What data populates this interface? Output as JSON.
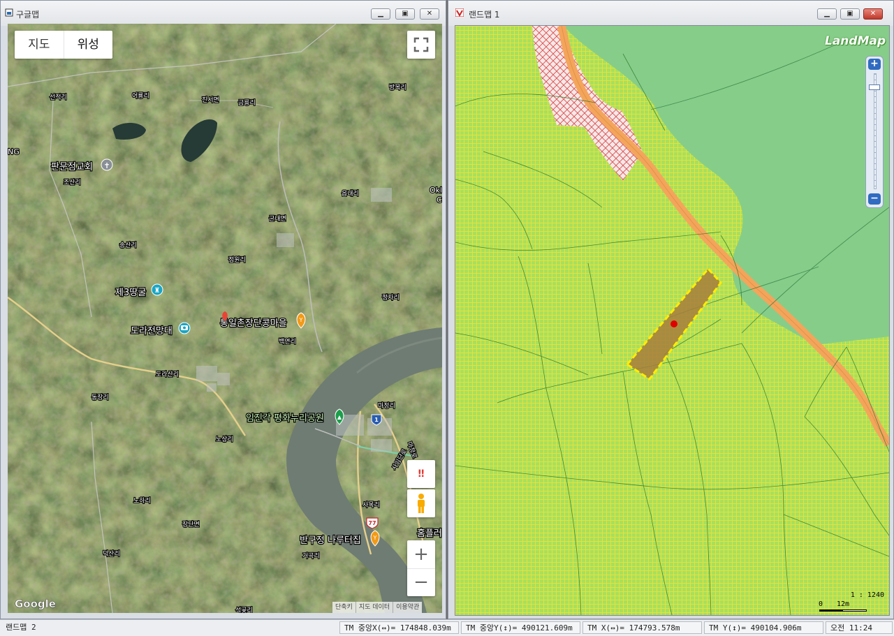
{
  "google_window": {
    "title": "구글맵",
    "controls": {
      "map_tab": "지도",
      "satellite_tab": "위성",
      "alert_glyph": "‼"
    },
    "labels_small": [
      "선적리",
      "어룡리",
      "진서면",
      "금릉리",
      "방목리",
      "조산리",
      "읍내리",
      "군내면",
      "송산리",
      "점원리",
      "정자리",
      "백연리",
      "도라산리",
      "마정리",
      "동장리",
      "노상리",
      "사목리",
      "노하리",
      "장단면",
      "거곡리",
      "덕산리",
      "석곶리",
      "NG",
      "Okl",
      "C",
      "마정로",
      "사임단로"
    ],
    "labels_large": [
      "판문점교회",
      "제3땅굴",
      "도라전망대",
      "통일촌장단콩마을",
      "임진각 평화누리공원",
      "반구정 나루터집",
      "홈플러"
    ],
    "road_shields": [
      "1",
      "77"
    ],
    "logo": "Google",
    "footer": [
      "단축키",
      "지도 데이터",
      "이용약관"
    ],
    "colors": {
      "water": "#6f7c73",
      "road": "#e6cf8c",
      "teal_road": "#7ccfa8"
    }
  },
  "landmap_window": {
    "title": "랜드맵 1",
    "logo": "LandMap",
    "scale": {
      "ratio": "1 : 1240",
      "zero": "0",
      "distance": "12m"
    },
    "colors": {
      "grid_fill": "#a6e05e",
      "grid_line": "#e6e23a",
      "forest": "#86cd89",
      "road": "#f4a55c",
      "hatch": "#dc4b4b",
      "parcel": "#a67d3c",
      "parcel_outline": "#ffee00",
      "marker": "#e00000"
    }
  },
  "statusbar": {
    "app": "랜드맵 2",
    "tm_center_x": "TM 중앙X(↔)= 174848.039m",
    "tm_center_y": "TM 중앙Y(↕)= 490121.609m",
    "tm_x": "TM X(↔)= 174793.578m",
    "tm_y": "TM Y(↕)= 490104.906m",
    "clock": "오전 11:24"
  }
}
